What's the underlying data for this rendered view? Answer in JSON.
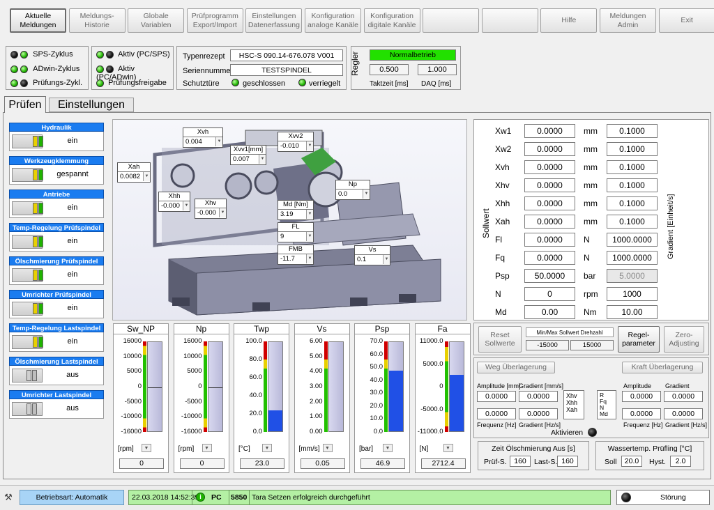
{
  "nav": {
    "buttons": [
      "Aktuelle Meldungen",
      "Meldungs- Historie",
      "Globale Variablen",
      "Prüfprogramm Export/Import",
      "Einstellungen Datenerfassung",
      "Konfiguration analoge Kanäle",
      "Konfiguration digitale Kanäle",
      "",
      "",
      "Hilfe",
      "Meldungen Admin",
      "Exit"
    ]
  },
  "status": {
    "leds": [
      "SPS-Zyklus",
      "ADwin-Zyklus",
      "Prüfungs-Zykl."
    ],
    "aktiv": [
      "Aktiv (PC/SPS)",
      "Aktiv (PC/ADwin)",
      "Prüfungsfreigabe"
    ]
  },
  "info": {
    "typenrezept_label": "Typenrezept",
    "typenrezept": "HSC-S 090.14-676.078 V001",
    "serien_label": "Seriennummer",
    "serien": "TESTSPINDEL",
    "schutz_label": "Schutztüre",
    "geschlossen": "geschlossen",
    "verriegelt": "verriegelt"
  },
  "regler": {
    "label": "Regler",
    "mode": "Normalbetrieb",
    "takt": "0.500",
    "daq": "1.000",
    "takt_label": "Taktzeit [ms]",
    "daq_label": "DAQ [ms]"
  },
  "tabs": [
    "Prüfen",
    "Einstellungen"
  ],
  "toggles": [
    {
      "title": "Hydraulik",
      "state": "ein",
      "on": true
    },
    {
      "title": "Werkzeugklemmung",
      "state": "gespannt",
      "on": true
    },
    {
      "title": "Antriebe",
      "state": "ein",
      "on": true
    },
    {
      "title": "Temp-Regelung Prüfspindel",
      "state": "ein",
      "on": true
    },
    {
      "title": "Ölschmierung Prüfspindel",
      "state": "ein",
      "on": true
    },
    {
      "title": "Umrichter Prüfspindel",
      "state": "ein",
      "on": true
    },
    {
      "title": "Temp-Regelung Lastspindel",
      "state": "ein",
      "on": true
    },
    {
      "title": "Ölschmierung Lastspindel",
      "state": "aus",
      "on": false
    },
    {
      "title": "Umrichter Lastspindel",
      "state": "aus",
      "on": false
    }
  ],
  "callouts": [
    {
      "label": "Xvh",
      "value": "0.004"
    },
    {
      "label": "Xvv2",
      "value": "-0.010"
    },
    {
      "label": "Xvv1[mm]",
      "value": "0.007"
    },
    {
      "label": "Xah",
      "value": "0.0082"
    },
    {
      "label": "Xhh",
      "value": "-0.000"
    },
    {
      "label": "Xhv",
      "value": "-0.000"
    },
    {
      "label": "Np",
      "value": "0.0"
    },
    {
      "label": "Md [Nm]",
      "value": "3.19"
    },
    {
      "label": "FL",
      "value": "9"
    },
    {
      "label": "FMB",
      "value": "-11.7"
    },
    {
      "label": "Vs",
      "value": "0.1"
    }
  ],
  "gauges": [
    {
      "title": "Sw_NP",
      "unit": "[rpm]",
      "value": "0",
      "min": -16000,
      "max": 16000,
      "fill": 0.5,
      "ticks": [
        "16000",
        "10000",
        "5000",
        "0",
        "-5000",
        "-10000",
        "-16000"
      ],
      "marker": true
    },
    {
      "title": "Np",
      "unit": "[rpm]",
      "value": "0",
      "min": -16000,
      "max": 16000,
      "fill": 0.5,
      "ticks": [
        "16000",
        "10000",
        "5000",
        "0",
        "-5000",
        "-10000",
        "-16000"
      ],
      "marker": true
    },
    {
      "title": "Twp",
      "unit": "[°C]",
      "value": "23.0",
      "min": 0,
      "max": 100,
      "fill": 0.23,
      "ticks": [
        "100.0",
        "80.0",
        "60.0",
        "40.0",
        "20.0",
        "0.0"
      ]
    },
    {
      "title": "Vs",
      "unit": "[mm/s]",
      "value": "0.05",
      "min": 0,
      "max": 6,
      "fill": 0.0,
      "ticks": [
        "6.00",
        "5.00",
        "4.00",
        "3.00",
        "2.00",
        "1.00",
        "0.00"
      ]
    },
    {
      "title": "Psp",
      "unit": "[bar]",
      "value": "46.9",
      "min": 0,
      "max": 70,
      "fill": 0.67,
      "ticks": [
        "70.0",
        "60.0",
        "50.0",
        "40.0",
        "30.0",
        "20.0",
        "10.0",
        "0.0"
      ]
    },
    {
      "title": "Fa",
      "unit": "[N]",
      "value": "2712.4",
      "min": -11000,
      "max": 11000,
      "fill": 0.62,
      "ticks": [
        "11000.0",
        "5000.0",
        "0",
        "-5000.0",
        "-11000.0"
      ],
      "band": true
    }
  ],
  "sollwert": {
    "side_label": "Sollwert",
    "grad_label": "Gradient [Einheit/s]",
    "rows": [
      {
        "name": "Xw1",
        "value": "0.0000",
        "unit": "mm",
        "grad": "0.1000"
      },
      {
        "name": "Xw2",
        "value": "0.0000",
        "unit": "mm",
        "grad": "0.1000"
      },
      {
        "name": "Xvh",
        "value": "0.0000",
        "unit": "mm",
        "grad": "0.1000"
      },
      {
        "name": "Xhv",
        "value": "0.0000",
        "unit": "mm",
        "grad": "0.1000"
      },
      {
        "name": "Xhh",
        "value": "0.0000",
        "unit": "mm",
        "grad": "0.1000"
      },
      {
        "name": "Xah",
        "value": "0.0000",
        "unit": "mm",
        "grad": "0.1000"
      },
      {
        "name": "Fl",
        "value": "0.0000",
        "unit": "N",
        "grad": "1000.0000"
      },
      {
        "name": "Fq",
        "value": "0.0000",
        "unit": "N",
        "grad": "1000.0000"
      },
      {
        "name": "Psp",
        "value": "50.0000",
        "unit": "bar",
        "grad": "5.0000",
        "grad_disabled": true
      },
      {
        "name": "N",
        "value": "0",
        "unit": "rpm",
        "grad": "1000"
      },
      {
        "name": "Md",
        "value": "0.00",
        "unit": "Nm",
        "grad": "10.00"
      }
    ]
  },
  "controls": {
    "reset": "Reset Sollwerte",
    "minmax_label": "Min/Max Sollwert Drehzahl",
    "min": "-15000",
    "max": "15000",
    "regel": "Regel- parameter",
    "zero": "Zero- Adjusting"
  },
  "ueber": {
    "weg": "Weg Überlagerung",
    "kraft": "Kraft Überlagerung",
    "amp_mm": "Amplitude [mm]",
    "grad_mms": "Gradient [mm/s]",
    "freq_hz": "Frequenz [Hz]",
    "grad_hzs": "Gradient [Hz/s]",
    "amp": "Amplitude",
    "grad": "Gradient",
    "vals": [
      "0.0000",
      "0.0000",
      "0.0000",
      "0.0000",
      "0.0000",
      "0.0000",
      "0.0000",
      "0.0000"
    ],
    "list1": [
      "Xhv",
      "Xhh",
      "Xah"
    ],
    "list2": [
      "R",
      "Fq",
      "N",
      "Md"
    ],
    "aktivieren": "Aktivieren"
  },
  "oel": {
    "title": "Zeit Ölschmierung Aus [s]",
    "pruef_label": "Prüf-S.",
    "pruef": "160",
    "last_label": "Last-S.",
    "last": "160"
  },
  "wasser": {
    "title": "Wassertemp. Prüfling [°C]",
    "soll_label": "Soll",
    "soll": "20.0",
    "hyst_label": "Hyst.",
    "hyst": "2.0"
  },
  "statusbar": {
    "mode": "Betriebsart: Automatik",
    "time": "22.03.2018 14:52:39",
    "pc": "PC",
    "code": "5850",
    "message": "Tara Setzen erfolgreich durchgeführt",
    "stoerung": "Störung"
  },
  "colors": {
    "blue": "#1a7cf0",
    "green_led": "#1fb300",
    "normal": "#22e000",
    "status_green": "#b4f0a4",
    "fill": "#2050e6"
  }
}
